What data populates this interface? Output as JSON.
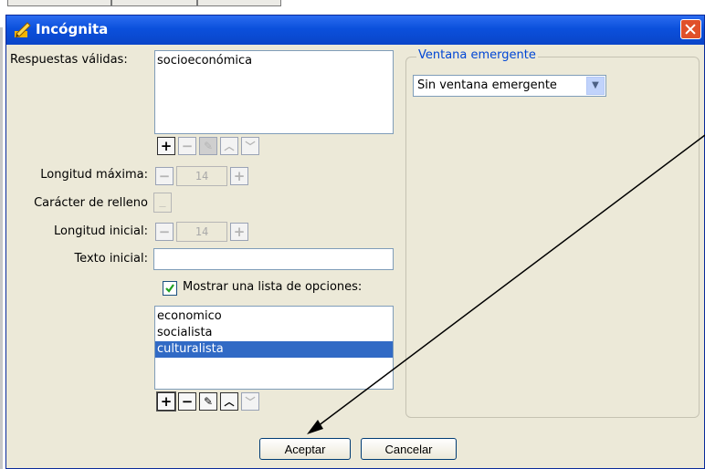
{
  "dialog": {
    "title": "Incógnita",
    "icon": "edit-icon"
  },
  "form": {
    "valid_answers_label": "Respuestas válidas:",
    "valid_answers": [
      "socioeconómica"
    ],
    "max_length_label": "Longitud máxima:",
    "max_length_value": "14",
    "fill_char_label": "Carácter de relleno",
    "fill_char_value": "_",
    "initial_length_label": "Longitud inicial:",
    "initial_length_value": "14",
    "initial_text_label": "Texto inicial:",
    "initial_text_value": "",
    "show_options_label": "Mostrar una lista de opciones:",
    "show_options_checked": true,
    "options": [
      {
        "label": "economico",
        "selected": false
      },
      {
        "label": "socialista",
        "selected": false
      },
      {
        "label": "culturalista",
        "selected": true
      }
    ]
  },
  "popup": {
    "group_label": "Ventana emergente",
    "selected_option": "Sin ventana emergente"
  },
  "buttons": {
    "accept": "Aceptar",
    "cancel": "Cancelar"
  },
  "toolbar_symbols": {
    "add": "+",
    "remove": "−",
    "edit": "✎",
    "up": "︿",
    "down": "﹀"
  },
  "colors": {
    "titlebar": "#0b50dc",
    "selection": "#316ac5",
    "legend": "#0046d5",
    "close": "#e0502a"
  }
}
